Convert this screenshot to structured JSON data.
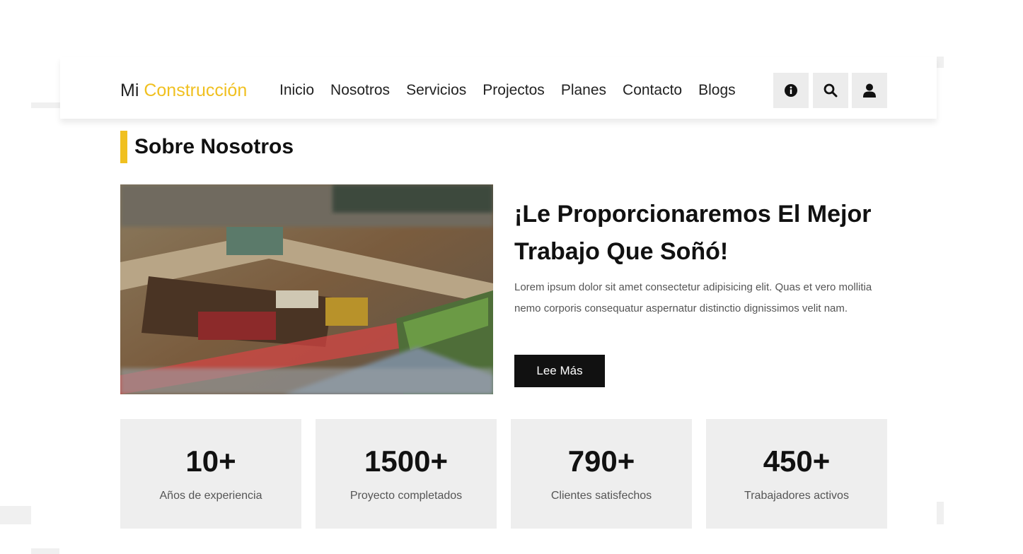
{
  "brand": {
    "prefix": "Mi",
    "accent": "Construcción"
  },
  "nav": {
    "links": [
      "Inicio",
      "Nosotros",
      "Servicios",
      "Projectos",
      "Planes",
      "Contacto",
      "Blogs"
    ],
    "icons": [
      "info-icon",
      "search-icon",
      "user-icon"
    ]
  },
  "about": {
    "section_title": "Sobre Nosotros",
    "headline": "¡Le Proporcionaremos El Mejor Trabajo Que Soñó!",
    "body": "Lorem ipsum dolor sit amet consectetur adipisicing elit. Quas et vero mollitia nemo corporis consequatur aspernatur distinctio dignissimos velit nam.",
    "button_label": "Lee Más"
  },
  "stats": [
    {
      "value": "10+",
      "label": "Años de experiencia"
    },
    {
      "value": "1500+",
      "label": "Proyecto completados"
    },
    {
      "value": "790+",
      "label": "Clientes satisfechos"
    },
    {
      "value": "450+",
      "label": "Trabajadores activos"
    }
  ],
  "colors": {
    "accent": "#f0c020",
    "dark_button": "#111111",
    "card_bg": "#eeeeee"
  }
}
